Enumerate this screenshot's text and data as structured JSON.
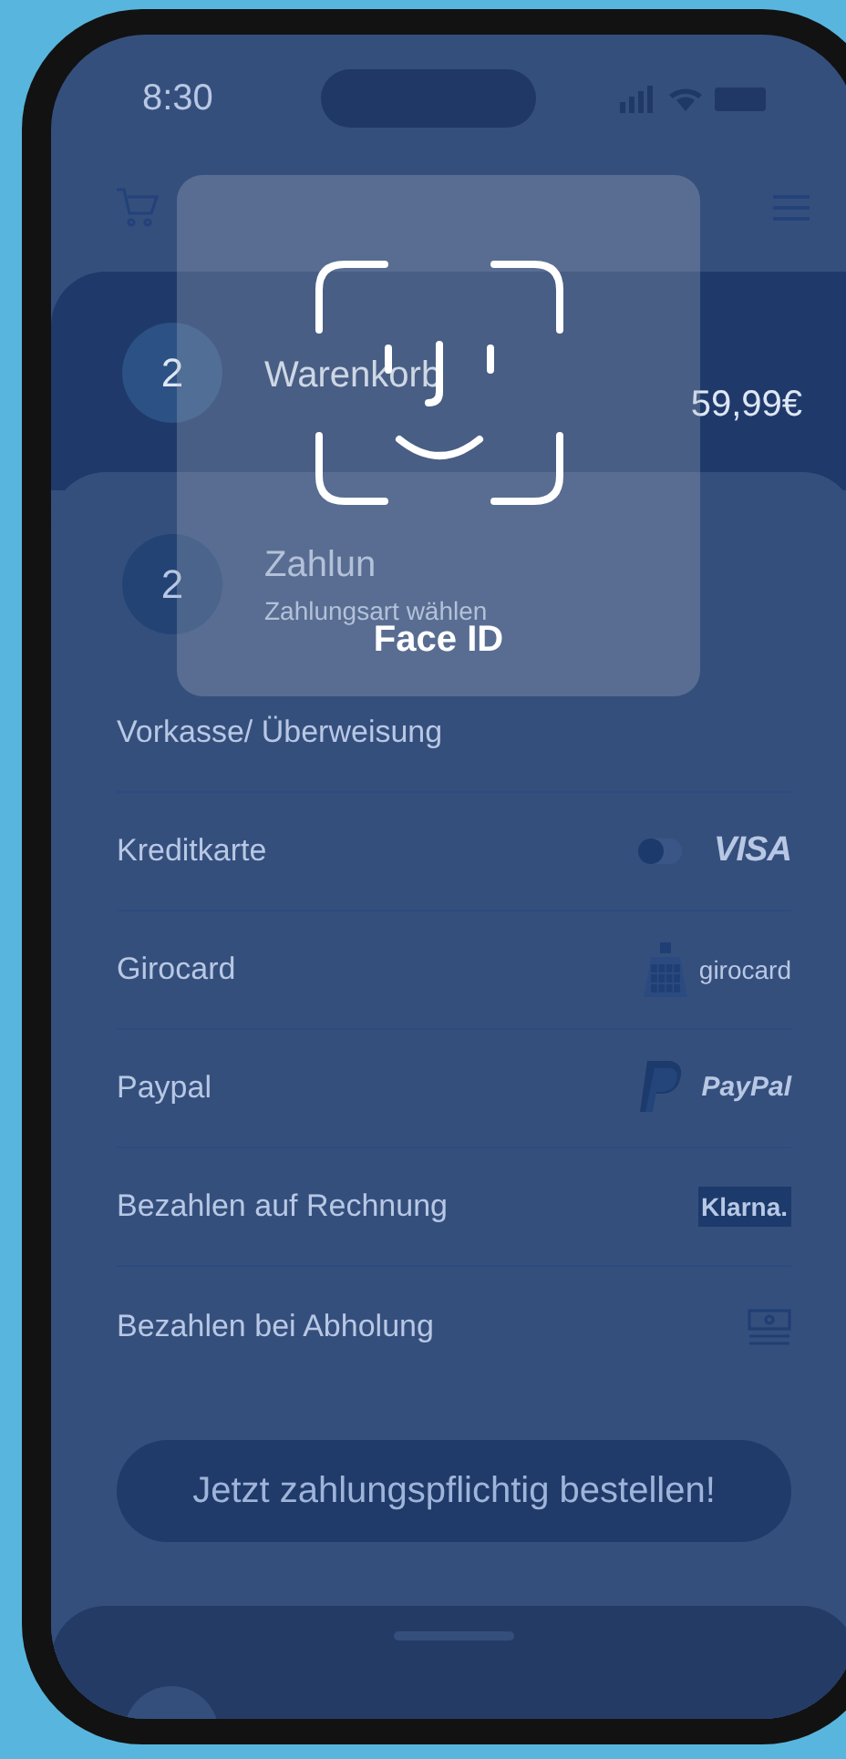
{
  "status_bar": {
    "time": "8:30"
  },
  "cart_step": {
    "number": "2",
    "title": "Warenkorb",
    "total": "59,99€"
  },
  "payment_step": {
    "number": "2",
    "title": "Zahlun",
    "subtitle": "Zahlungsart wählen"
  },
  "payment_methods": [
    {
      "label": "Vorkasse/ Überweisung",
      "kind": "none"
    },
    {
      "label": "Kreditkarte",
      "kind": "visa",
      "logo": "VISA",
      "toggle": {
        "on": false
      }
    },
    {
      "label": "Girocard",
      "kind": "girocard",
      "logo": "girocard"
    },
    {
      "label": "Paypal",
      "kind": "paypal",
      "logo": "PayPal"
    },
    {
      "label": "Bezahlen auf Rechnung",
      "kind": "klarna",
      "logo": "Klarna."
    },
    {
      "label": "Bezahlen bei Abholung",
      "kind": "cash"
    }
  ],
  "order_button": "Jetzt zahlungspflichtig bestellen!",
  "face_id": {
    "label": "Face ID"
  }
}
